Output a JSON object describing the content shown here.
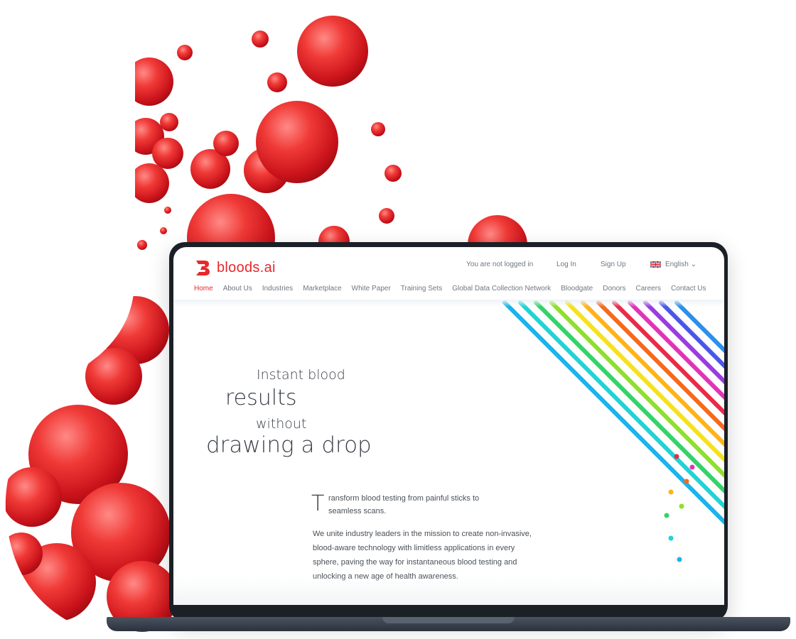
{
  "site": {
    "logo_text": "bloods.ai",
    "accent_color": "#e8282b"
  },
  "topbar": {
    "login_status": "You are not logged in",
    "login_link": "Log In",
    "signup_link": "Sign Up",
    "language": "English",
    "language_icon": "uk-flag-icon",
    "dropdown_icon": "chevron-down-icon"
  },
  "nav": {
    "items": [
      {
        "label": "Home",
        "active": true
      },
      {
        "label": "About Us"
      },
      {
        "label": "Industries"
      },
      {
        "label": "Marketplace"
      },
      {
        "label": "White Paper"
      },
      {
        "label": "Training Sets"
      },
      {
        "label": "Global Data Collection Network"
      },
      {
        "label": "Bloodgate"
      },
      {
        "label": "Donors"
      },
      {
        "label": "Careers"
      },
      {
        "label": "Contact Us"
      }
    ]
  },
  "hero": {
    "line1": "Instant blood",
    "line2": "results",
    "line3": "without",
    "line4": "drawing a drop"
  },
  "intro": {
    "drop_cap": "T",
    "lead": "ransform blood testing from painful sticks to seamless scans.",
    "body": "We unite industry leaders in the mission to create non-invasive, blood-aware technology with limitless applications in every sphere, paving the way for instantaneous blood testing and unlocking a new age of health awareness."
  },
  "stripe_colors": [
    "#1bb4ea",
    "#22d3d3",
    "#35d26a",
    "#8ee02a",
    "#f5e21c",
    "#ffb31a",
    "#f46a1e",
    "#ea2a4a",
    "#e233b8",
    "#9b3be0",
    "#4a57e6",
    "#2c90ea"
  ]
}
